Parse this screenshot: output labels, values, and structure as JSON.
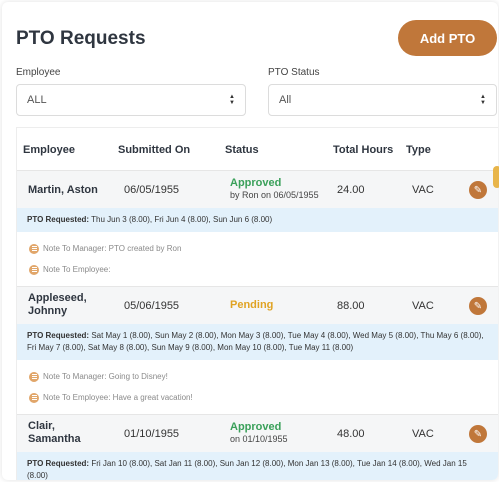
{
  "colors": {
    "accent": "#c0773a",
    "approved": "#3aa05a",
    "pending": "#e0a323",
    "note_icon": "#e1a66a",
    "side_tab": "#e8b54a"
  },
  "header": {
    "title": "PTO Requests",
    "add_button": "Add PTO"
  },
  "filters": {
    "employee": {
      "label": "Employee",
      "value": "ALL"
    },
    "status": {
      "label": "PTO Status",
      "value": "All"
    }
  },
  "table": {
    "columns": [
      "Employee",
      "Submitted On",
      "Status",
      "Total Hours",
      "Type"
    ],
    "rows": [
      {
        "employee": "Martin, Aston",
        "submitted": "06/05/1955",
        "status": "Approved",
        "status_by": "by Ron on 06/05/1955",
        "hours": "24.00",
        "type": "VAC",
        "pto_label": "PTO Requested:",
        "pto_days": "Thu Jun 3 (8.00), Fri Jun 4 (8.00), Sun Jun 6 (8.00)",
        "note_manager": "Note To Manager: PTO created by Ron",
        "note_employee": "Note To Employee:"
      },
      {
        "employee_l1": "Appleseed,",
        "employee_l2": "Johnny",
        "submitted": "05/06/1955",
        "status": "Pending",
        "hours": "88.00",
        "type": "VAC",
        "pto_label": "PTO Requested:",
        "pto_days": "Sat May 1 (8.00), Sun May 2 (8.00), Mon May 3 (8.00), Tue May 4 (8.00), Wed May 5 (8.00), Thu May 6 (8.00), Fri May 7 (8.00), Sat May 8 (8.00), Sun May 9 (8.00), Mon May 10 (8.00), Tue May 11 (8.00)",
        "note_manager": "Note To Manager: Going to Disney!",
        "note_employee": "Note To Employee: Have a great vacation!"
      },
      {
        "employee_l1": "Clair,",
        "employee_l2": "Samantha",
        "submitted": "01/10/1955",
        "status": "Approved",
        "status_by": "on 01/10/1955",
        "hours": "48.00",
        "type": "VAC",
        "pto_label": "PTO Requested:",
        "pto_days": "Fri Jan 10 (8.00), Sat Jan 11 (8.00), Sun Jan 12 (8.00), Mon Jan 13 (8.00), Tue Jan 14 (8.00), Wed Jan 15 (8.00)"
      }
    ]
  }
}
